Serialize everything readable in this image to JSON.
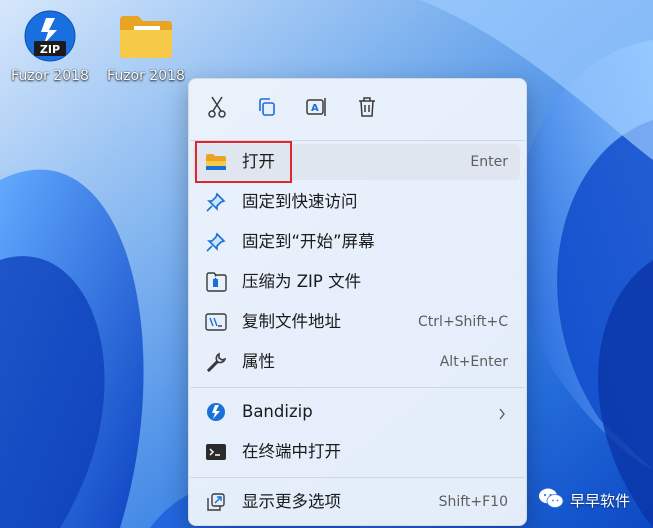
{
  "desktop": {
    "icons": [
      {
        "label": "Fuzor 2018",
        "icon": "zip-archive-icon"
      },
      {
        "label": "Fuzor 2018",
        "icon": "folder-icon"
      }
    ]
  },
  "context_menu": {
    "toolbar": [
      {
        "icon": "cut-icon"
      },
      {
        "icon": "copy-icon"
      },
      {
        "icon": "rename-icon"
      },
      {
        "icon": "delete-icon"
      }
    ],
    "items": [
      {
        "label": "打开",
        "shortcut": "Enter",
        "icon": "folder-open-icon"
      },
      {
        "label": "固定到快速访问",
        "shortcut": "",
        "icon": "pin-icon"
      },
      {
        "label": "固定到“开始”屏幕",
        "shortcut": "",
        "icon": "pin-start-icon"
      },
      {
        "label": "压缩为 ZIP 文件",
        "shortcut": "",
        "icon": "zip-folder-icon"
      },
      {
        "label": "复制文件地址",
        "shortcut": "Ctrl+Shift+C",
        "icon": "copy-path-icon"
      },
      {
        "label": "属性",
        "shortcut": "Alt+Enter",
        "icon": "wrench-icon"
      },
      {
        "label": "Bandizip",
        "shortcut": "",
        "icon": "bandizip-icon"
      },
      {
        "label": "在终端中打开",
        "shortcut": "",
        "icon": "terminal-icon"
      },
      {
        "label": "显示更多选项",
        "shortcut": "Shift+F10",
        "icon": "more-options-icon"
      }
    ]
  },
  "watermark": {
    "text": "早早软件",
    "icon": "wechat-icon"
  },
  "colors": {
    "accent": "#0067c0",
    "highlight_border": "#e0262b",
    "menu_bg": "#ecf2fb",
    "wallpaper": "#1f6fe0"
  }
}
